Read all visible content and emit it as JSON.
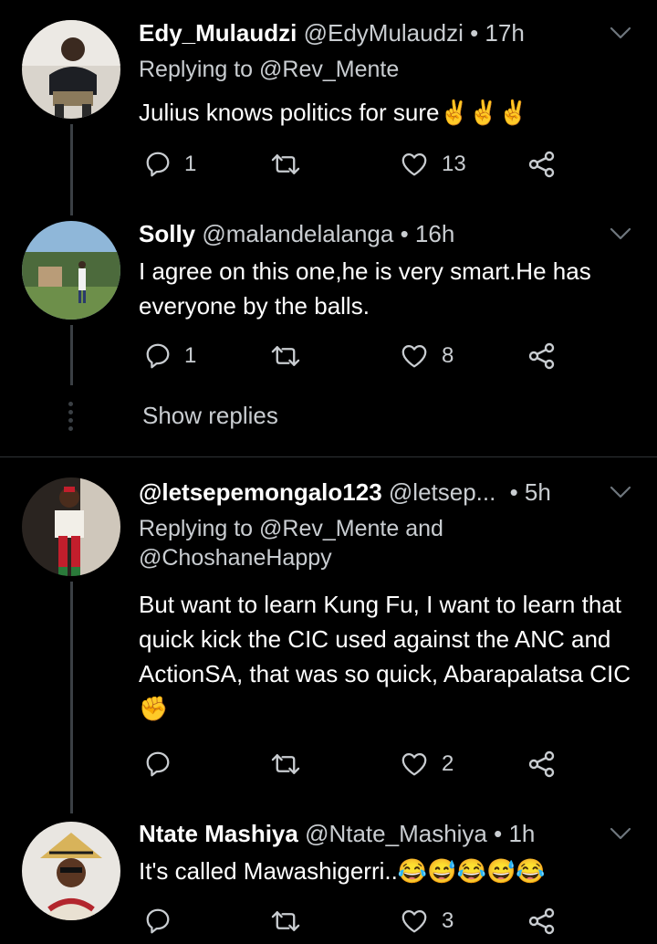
{
  "tweets": [
    {
      "name": "Edy_Mulaudzi",
      "handle": "@EdyMulaudzi",
      "time": "• 17h",
      "replying": "Replying to @Rev_Mente",
      "text": "Julius knows politics for sure✌️✌️✌️",
      "replies": "1",
      "retweets": "",
      "likes": "13"
    },
    {
      "name": "Solly",
      "handle": "@malandelalanga",
      "time": "• 16h",
      "text": "I agree on this one,he is very smart.He has everyone by the balls.",
      "replies": "1",
      "retweets": "",
      "likes": "8",
      "show_replies": "Show replies"
    },
    {
      "name": "@letsepemongalo123",
      "handle": "@letsep...",
      "time": "• 5h",
      "replying_line1": "Replying to @Rev_Mente and",
      "replying_line2": "@ChoshaneHappy",
      "text": "But want to learn Kung Fu, I want to learn that quick kick the CIC used against the ANC and ActionSA, that was so quick, Abarapalatsa CIC✊",
      "replies": "",
      "retweets": "",
      "likes": "2"
    },
    {
      "name": "Ntate Mashiya",
      "handle": "@Ntate_Mashiya",
      "time": "• 1h",
      "text": "It's called Mawashigerri..😂😅😂😅😂",
      "replies": "",
      "retweets": "",
      "likes": "3"
    }
  ],
  "icons": {
    "reply": "reply-icon",
    "retweet": "retweet-icon",
    "like": "heart-icon",
    "share": "share-icon",
    "menu": "chevron-down-icon"
  },
  "colors": {
    "background": "#000000",
    "secondary_text": "#c9cdd1",
    "divider": "#2f3336",
    "emoji_yellow": "#f7b928"
  }
}
